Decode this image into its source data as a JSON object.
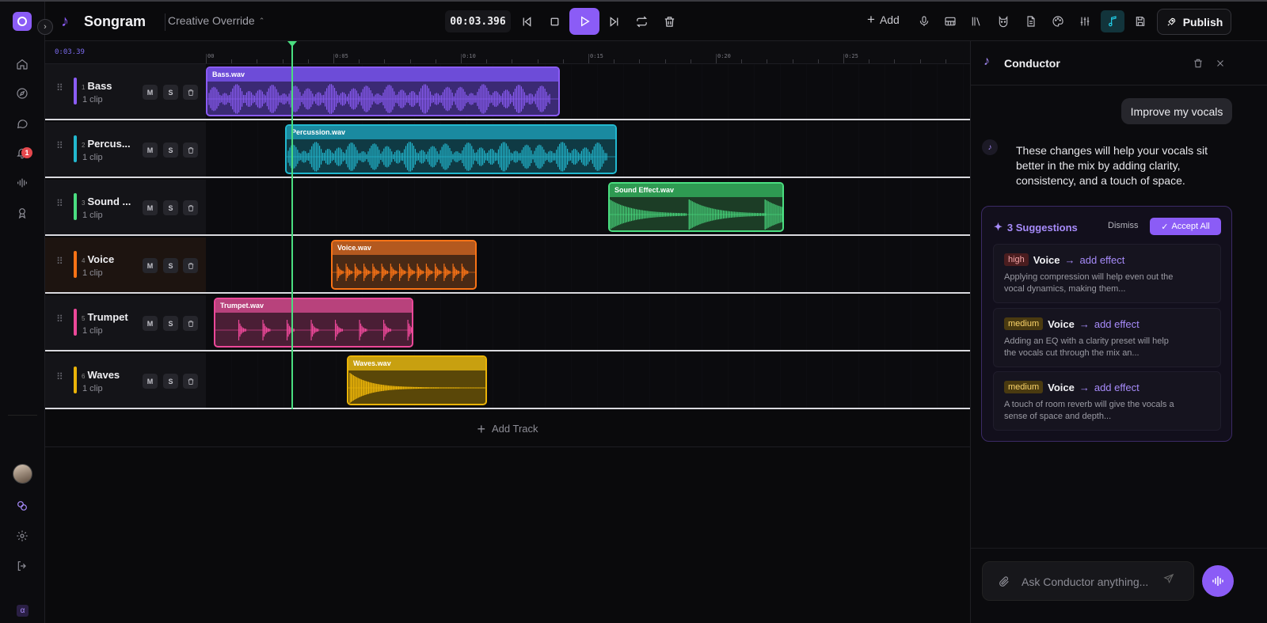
{
  "app": {
    "title": "Songram",
    "project": "Creative Override"
  },
  "transport": {
    "timecode": "00:03.396"
  },
  "toolbar": {
    "add_label": "Add",
    "publish_label": "Publish"
  },
  "rail": {
    "notification_count": "1",
    "alpha_label": "α"
  },
  "ruler": {
    "current": "0:03.39",
    "labels": [
      "00",
      "0:05",
      "0:10",
      "0:15",
      "0:20",
      "0:25"
    ]
  },
  "tracks": [
    {
      "num": "1",
      "name": "Bass",
      "clips": "1 clip",
      "color": "#8b5cf6",
      "clip_name": "Bass.wav"
    },
    {
      "num": "2",
      "name": "Percus...",
      "clips": "1 clip",
      "color": "#22b8cf",
      "clip_name": "Percussion.wav"
    },
    {
      "num": "3",
      "name": "Sound ...",
      "clips": "1 clip",
      "color": "#4ade80",
      "clip_name": "Sound Effect.wav"
    },
    {
      "num": "4",
      "name": "Voice",
      "clips": "1 clip",
      "color": "#f97316",
      "clip_name": "Voice.wav"
    },
    {
      "num": "5",
      "name": "Trumpet",
      "clips": "1 clip",
      "color": "#ec4899",
      "clip_name": "Trumpet.wav"
    },
    {
      "num": "6",
      "name": "Waves",
      "clips": "1 clip",
      "color": "#eab308",
      "clip_name": "Waves.wav"
    }
  ],
  "track_buttons": {
    "mute": "M",
    "solo": "S"
  },
  "add_track_label": "Add Track",
  "conductor": {
    "title": "Conductor",
    "user_message": "Improve my vocals",
    "bot_message": "These changes will help your vocals sit better in the mix by adding clarity, consistency, and a touch of space.",
    "suggestions_title": "3 Suggestions",
    "dismiss_label": "Dismiss",
    "accept_all_label": "Accept All",
    "suggestions": [
      {
        "priority": "high",
        "target": "Voice",
        "arrow": "→",
        "action": "add effect",
        "desc": "Applying compression will help even out the vocal dynamics, making them..."
      },
      {
        "priority": "medium",
        "target": "Voice",
        "arrow": "→",
        "action": "add effect",
        "desc": "Adding an EQ with a clarity preset will help the vocals cut through the mix an..."
      },
      {
        "priority": "medium",
        "target": "Voice",
        "arrow": "→",
        "action": "add effect",
        "desc": "A touch of room reverb will give the vocals a sense of space and depth..."
      }
    ],
    "input_placeholder": "Ask Conductor anything..."
  }
}
